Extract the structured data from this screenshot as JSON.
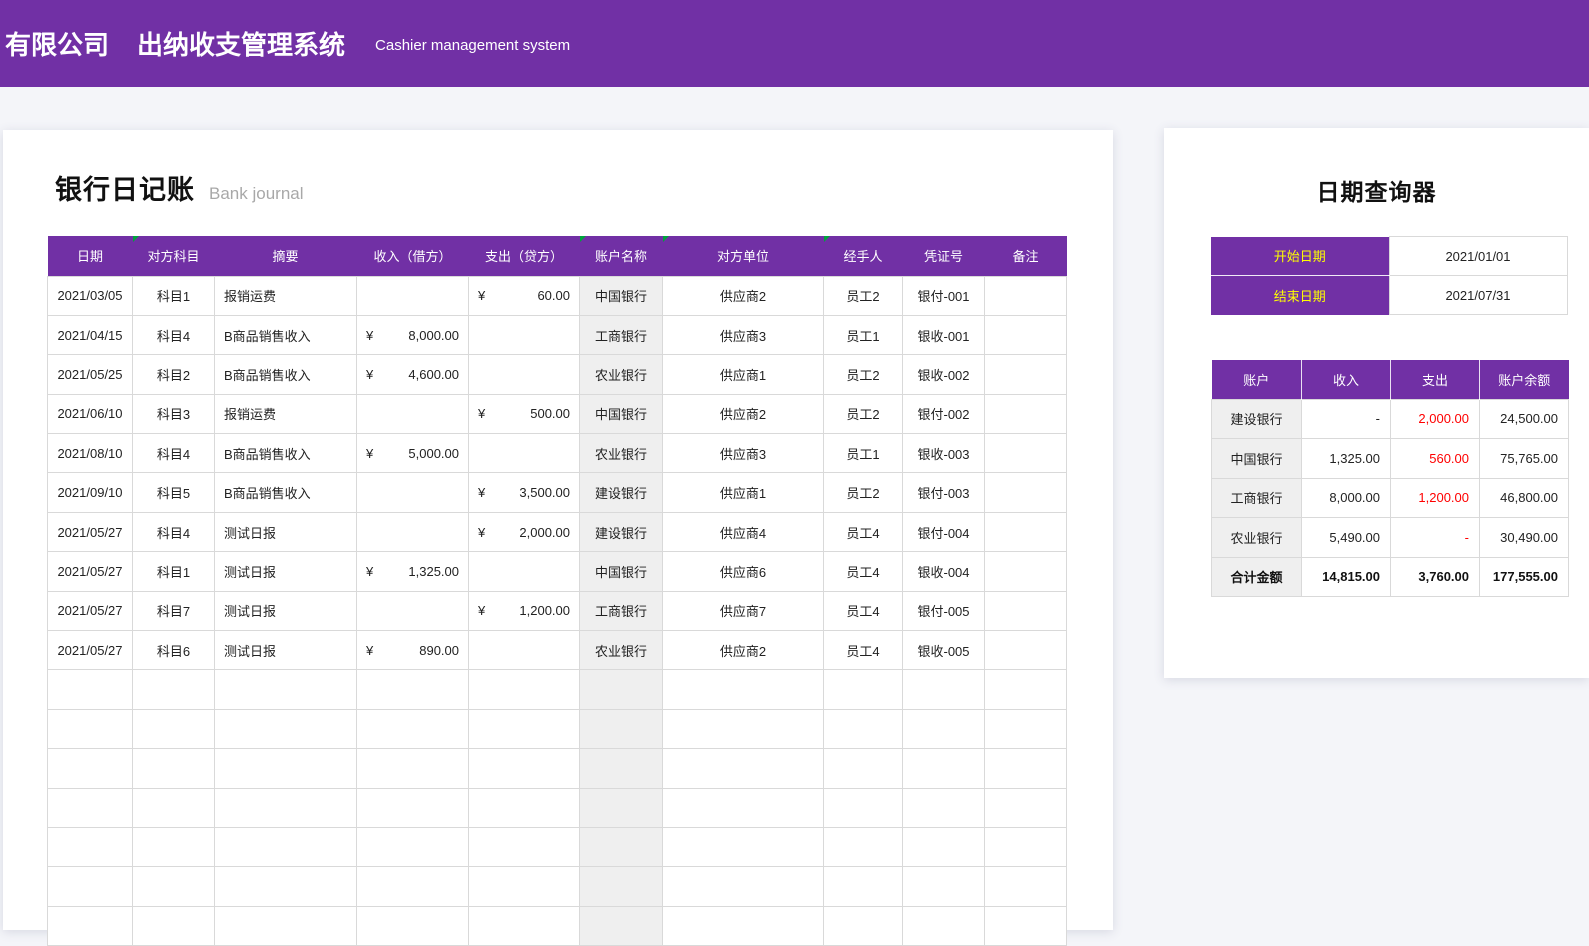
{
  "banner": {
    "company": "有限公司",
    "system_title": "出纳收支管理系统",
    "subtitle": "Cashier management system"
  },
  "journal": {
    "title": "银行日记账",
    "subtitle": "Bank journal",
    "currency_symbol": "¥",
    "columns": [
      {
        "key": "date",
        "label": "日期",
        "flag": false
      },
      {
        "key": "subject",
        "label": "对方科目",
        "flag": true
      },
      {
        "key": "summary",
        "label": "摘要",
        "flag": false
      },
      {
        "key": "income",
        "label": "收入（借方）",
        "flag": false
      },
      {
        "key": "expense",
        "label": "支出（贷方）",
        "flag": false
      },
      {
        "key": "account",
        "label": "账户名称",
        "flag": true
      },
      {
        "key": "counterparty",
        "label": "对方单位",
        "flag": true
      },
      {
        "key": "handler",
        "label": "经手人",
        "flag": true
      },
      {
        "key": "voucher",
        "label": "凭证号",
        "flag": false
      },
      {
        "key": "remark",
        "label": "备注",
        "flag": false
      }
    ],
    "rows": [
      {
        "date": "2021/03/05",
        "subject": "科目1",
        "summary": "报销运费",
        "income": "",
        "expense": "60.00",
        "account": "中国银行",
        "counterparty": "供应商2",
        "handler": "员工2",
        "voucher": "银付-001",
        "remark": ""
      },
      {
        "date": "2021/04/15",
        "subject": "科目4",
        "summary": "B商品销售收入",
        "income": "8,000.00",
        "expense": "",
        "account": "工商银行",
        "counterparty": "供应商3",
        "handler": "员工1",
        "voucher": "银收-001",
        "remark": ""
      },
      {
        "date": "2021/05/25",
        "subject": "科目2",
        "summary": "B商品销售收入",
        "income": "4,600.00",
        "expense": "",
        "account": "农业银行",
        "counterparty": "供应商1",
        "handler": "员工2",
        "voucher": "银收-002",
        "remark": ""
      },
      {
        "date": "2021/06/10",
        "subject": "科目3",
        "summary": "报销运费",
        "income": "",
        "expense": "500.00",
        "account": "中国银行",
        "counterparty": "供应商2",
        "handler": "员工2",
        "voucher": "银付-002",
        "remark": ""
      },
      {
        "date": "2021/08/10",
        "subject": "科目4",
        "summary": "B商品销售收入",
        "income": "5,000.00",
        "expense": "",
        "account": "农业银行",
        "counterparty": "供应商3",
        "handler": "员工1",
        "voucher": "银收-003",
        "remark": ""
      },
      {
        "date": "2021/09/10",
        "subject": "科目5",
        "summary": "B商品销售收入",
        "income": "",
        "expense": "3,500.00",
        "account": "建设银行",
        "counterparty": "供应商1",
        "handler": "员工2",
        "voucher": "银付-003",
        "remark": ""
      },
      {
        "date": "2021/05/27",
        "subject": "科目4",
        "summary": "测试日报",
        "income": "",
        "expense": "2,000.00",
        "account": "建设银行",
        "counterparty": "供应商4",
        "handler": "员工4",
        "voucher": "银付-004",
        "remark": ""
      },
      {
        "date": "2021/05/27",
        "subject": "科目1",
        "summary": "测试日报",
        "income": "1,325.00",
        "expense": "",
        "account": "中国银行",
        "counterparty": "供应商6",
        "handler": "员工4",
        "voucher": "银收-004",
        "remark": ""
      },
      {
        "date": "2021/05/27",
        "subject": "科目7",
        "summary": "测试日报",
        "income": "",
        "expense": "1,200.00",
        "account": "工商银行",
        "counterparty": "供应商7",
        "handler": "员工4",
        "voucher": "银付-005",
        "remark": ""
      },
      {
        "date": "2021/05/27",
        "subject": "科目6",
        "summary": "测试日报",
        "income": "890.00",
        "expense": "",
        "account": "农业银行",
        "counterparty": "供应商2",
        "handler": "员工4",
        "voucher": "银收-005",
        "remark": ""
      }
    ],
    "empty_row_count": 7
  },
  "query": {
    "title": "日期查询器",
    "start_label": "开始日期",
    "start_value": "2021/01/01",
    "end_label": "结束日期",
    "end_value": "2021/07/31",
    "summary": {
      "columns": [
        "账户",
        "收入",
        "支出",
        "账户余额"
      ],
      "rows": [
        {
          "account": "建设银行",
          "income": "-",
          "expense": "2,000.00",
          "balance": "24,500.00"
        },
        {
          "account": "中国银行",
          "income": "1,325.00",
          "expense": "560.00",
          "balance": "75,765.00"
        },
        {
          "account": "工商银行",
          "income": "8,000.00",
          "expense": "1,200.00",
          "balance": "46,800.00"
        },
        {
          "account": "农业银行",
          "income": "5,490.00",
          "expense": "-",
          "balance": "30,490.00"
        }
      ],
      "total": {
        "label": "合计金额",
        "income": "14,815.00",
        "expense": "3,760.00",
        "balance": "177,555.00"
      }
    }
  },
  "colors": {
    "purple": "#7130A5",
    "label_yellow": "#FFFF00",
    "expense_red": "#FF0000",
    "flag_green": "#00A43B",
    "column_highlight": "#EFEFEF",
    "page_bg": "#F4F5F9"
  }
}
